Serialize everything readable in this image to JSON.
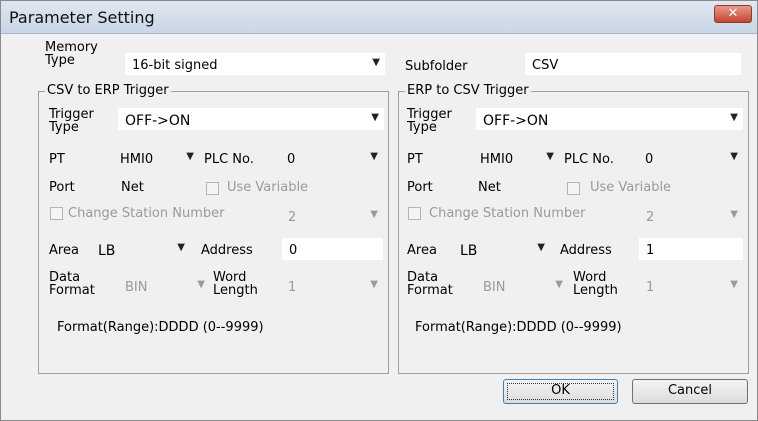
{
  "window": {
    "title": "Parameter Setting",
    "close_symbol": "✕"
  },
  "top": {
    "memory_type_label": "Memory Type",
    "memory_type_value": "16-bit signed",
    "subfolder_label": "Subfolder",
    "subfolder_value": "CSV"
  },
  "groups": [
    {
      "title": "CSV to ERP Trigger",
      "trigger_type_label": "Trigger Type",
      "trigger_type_value": "OFF->ON",
      "pt_label": "PT",
      "pt_value": "HMI0",
      "plc_no_label": "PLC No.",
      "plc_no_value": "0",
      "port_label": "Port",
      "port_value": "Net",
      "use_variable_label": "Use Variable",
      "change_station_label": "Change Station Number",
      "change_station_value": "2",
      "area_label": "Area",
      "area_value": "LB",
      "address_label": "Address",
      "address_value": "0",
      "data_format_label": "Data Format",
      "data_format_value": "BIN",
      "word_length_label": "Word Length",
      "word_length_value": "1",
      "format_range": "Format(Range):DDDD (0--9999)"
    },
    {
      "title": "ERP to CSV Trigger",
      "trigger_type_label": "Trigger Type",
      "trigger_type_value": "OFF->ON",
      "pt_label": "PT",
      "pt_value": "HMI0",
      "plc_no_label": "PLC No.",
      "plc_no_value": "0",
      "port_label": "Port",
      "port_value": "Net",
      "use_variable_label": "Use Variable",
      "change_station_label": "Change Station Number",
      "change_station_value": "2",
      "area_label": "Area",
      "area_value": "LB",
      "address_label": "Address",
      "address_value": "1",
      "data_format_label": "Data Format",
      "data_format_value": "BIN",
      "word_length_label": "Word Length",
      "word_length_value": "1",
      "format_range": "Format(Range):DDDD (0--9999)"
    }
  ],
  "buttons": {
    "ok": "OK",
    "cancel": "Cancel"
  },
  "icons": {
    "dropdown": "chevron-down-icon",
    "close": "close-icon"
  }
}
